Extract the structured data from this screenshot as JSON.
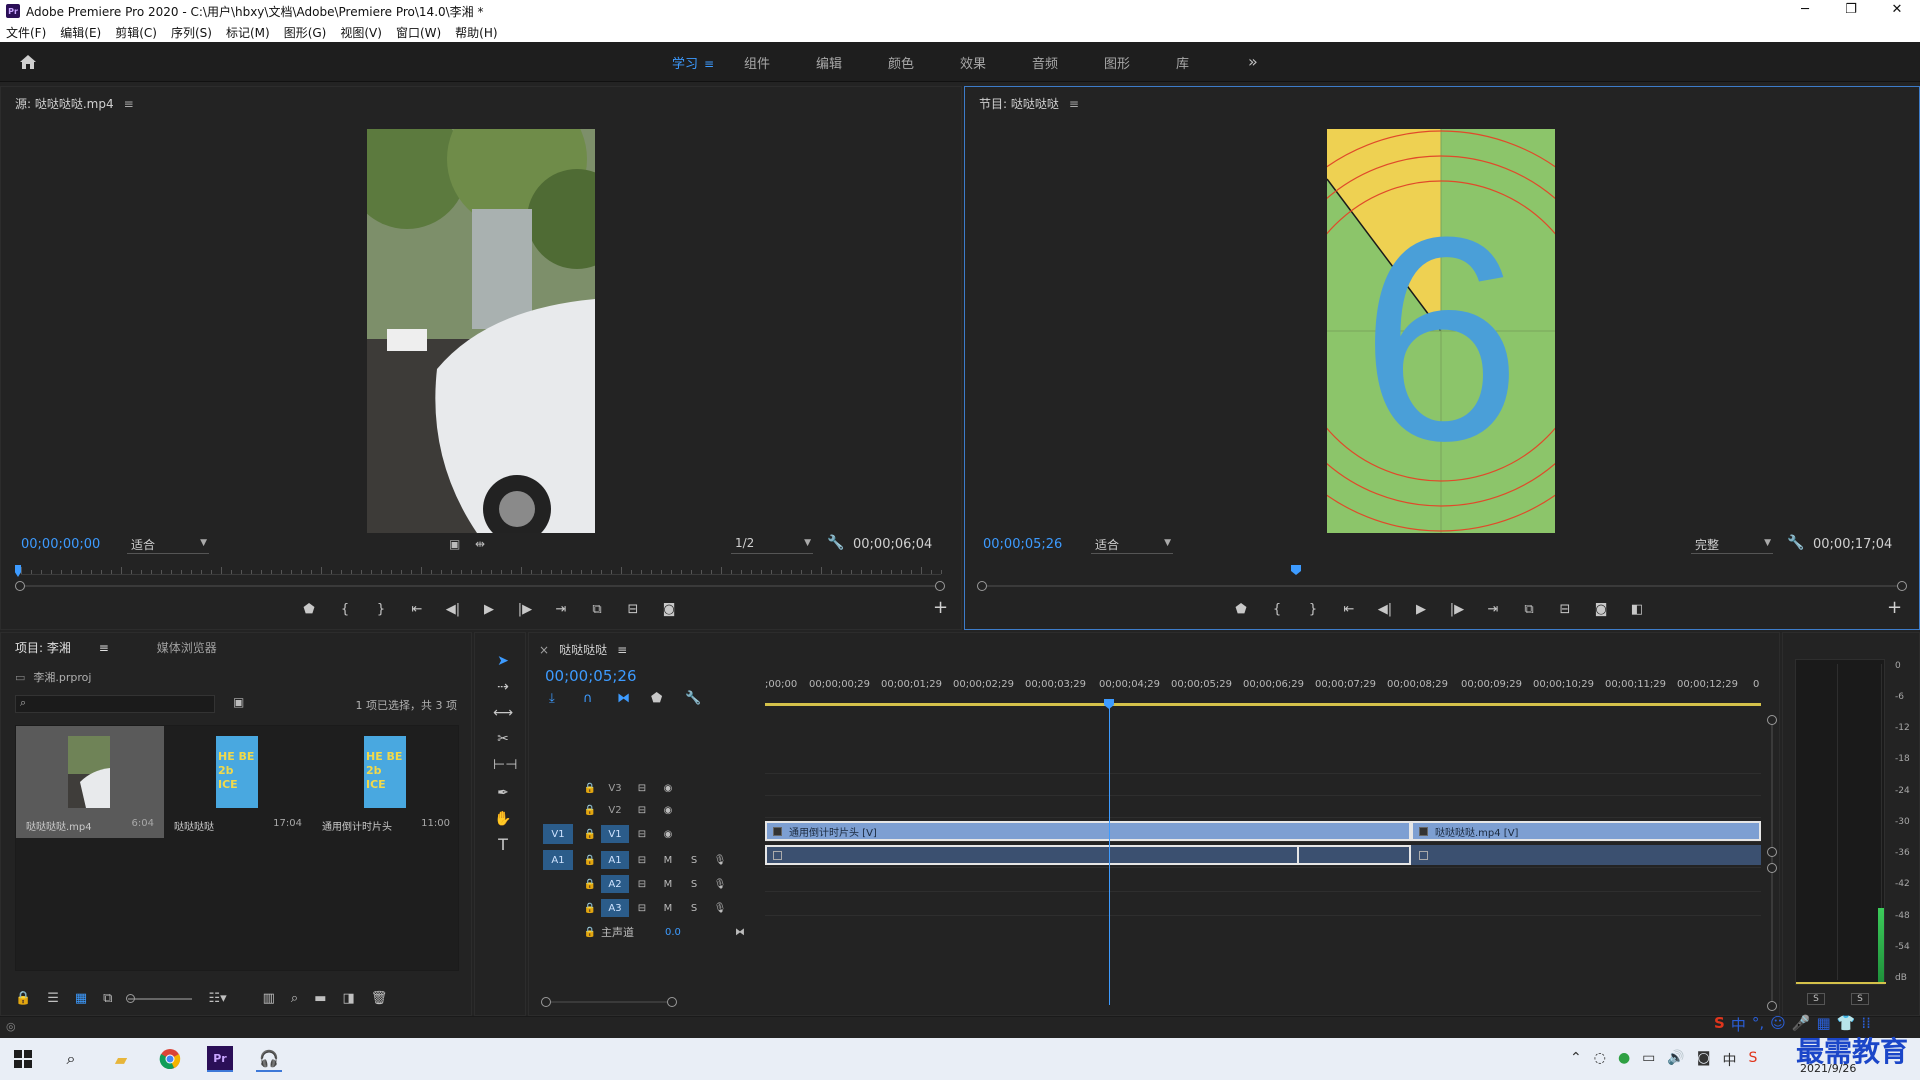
{
  "window": {
    "title": "Adobe Premiere Pro 2020 - C:\\用户\\hbxy\\文档\\Adobe\\Premiere Pro\\14.0\\李湘 *",
    "app_badge": "Pr",
    "minimize": "─",
    "maximize": "❐",
    "close": "✕"
  },
  "menu": [
    "文件(F)",
    "编辑(E)",
    "剪辑(C)",
    "序列(S)",
    "标记(M)",
    "图形(G)",
    "视图(V)",
    "窗口(W)",
    "帮助(H)"
  ],
  "workspaces": {
    "tabs": [
      "学习",
      "组件",
      "编辑",
      "颜色",
      "效果",
      "音频",
      "图形",
      "库"
    ],
    "active": "学习",
    "menu_glyph": "≡",
    "more_glyph": "»"
  },
  "source": {
    "title": "源: 哒哒哒哒.mp4",
    "menu_glyph": "≡",
    "timecode": "00;00;00;00",
    "fit": "适合",
    "resolution": "1/2",
    "duration": "00;00;06;04"
  },
  "program": {
    "title": "节目: 哒哒哒哒",
    "menu_glyph": "≡",
    "timecode": "00;00;05;26",
    "fit": "适合",
    "quality": "完整",
    "duration": "00;00;17;04",
    "countdown_digit": "6"
  },
  "project": {
    "tab_active": "项目: 李湘",
    "tab_menu": "≡",
    "tab_inactive": "媒体浏览器",
    "file": "李湘.prproj",
    "selection": "1 项已选择，共 3 项",
    "items": [
      {
        "name": "哒哒哒哒.mp4",
        "duration": "6:04"
      },
      {
        "name": "哒哒哒哒",
        "duration": "17:04"
      },
      {
        "name": "通用倒计时片头",
        "duration": "11:00"
      }
    ],
    "leader_text": "HE BE 2b ICE"
  },
  "timeline": {
    "sequence": "哒哒哒哒",
    "close_glyph": "×",
    "menu_glyph": "≡",
    "timecode": "00;00;05;26",
    "ruler": [
      ";00;00",
      "00;00;00;29",
      "00;00;01;29",
      "00;00;02;29",
      "00;00;03;29",
      "00;00;04;29",
      "00;00;05;29",
      "00;00;06;29",
      "00;00;07;29",
      "00;00;08;29",
      "00;00;09;29",
      "00;00;10;29",
      "00;00;11;29",
      "00;00;12;29",
      "0"
    ],
    "tracks": {
      "v3": "V3",
      "v2": "V2",
      "v1": "V1",
      "a1": "A1",
      "a2": "A2",
      "a3": "A3",
      "v1_patch": "V1",
      "a1_patch": "A1",
      "mute": "M",
      "solo": "S",
      "master": "主声道",
      "master_value": "0.0"
    },
    "clips": {
      "leader_v": "通用倒计时片头 [V]",
      "video_v": "哒哒哒哒.mp4 [V]"
    }
  },
  "meters": {
    "db": [
      "0",
      "-6",
      "-12",
      "-18",
      "-24",
      "-30",
      "-36",
      "-42",
      "-48",
      "-54",
      "dB"
    ],
    "solo_left": "S",
    "solo_right": "S"
  },
  "taskbar": {
    "date": "2021/9/26",
    "watermark": "最需教育",
    "ime": [
      "中",
      "°,",
      "☺",
      "🎤",
      "▦",
      "👕",
      "⁞⁞"
    ]
  }
}
